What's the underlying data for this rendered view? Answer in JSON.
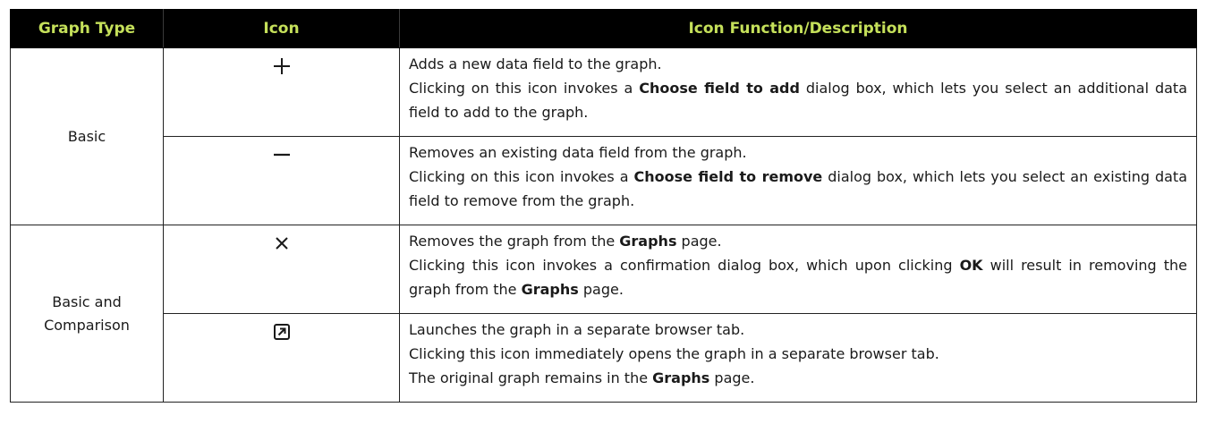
{
  "columns": {
    "graph_type": "Graph Type",
    "icon": "Icon",
    "description": "Icon Function/Description"
  },
  "groups": [
    {
      "graph_type": "Basic",
      "rows": [
        {
          "icon_name": "plus-icon",
          "summary": "Adds a new data field to the graph.",
          "detail": {
            "pre": "Clicking on this icon invokes a ",
            "bold": "Choose field to add",
            "post": " dialog box, which lets you select an additional data field to add to the graph."
          }
        },
        {
          "icon_name": "minus-icon",
          "summary": "Removes an existing data field from the graph.",
          "detail": {
            "pre": "Clicking on this icon invokes a ",
            "bold": "Choose field to remove",
            "post": " dialog box, which lets you select an existing data field to remove from the graph."
          }
        }
      ]
    },
    {
      "graph_type": "Basic and Comparison",
      "rows": [
        {
          "icon_name": "close-icon",
          "summary": {
            "pre": "Removes the graph from the ",
            "bold": "Graphs",
            "post": " page."
          },
          "detail": {
            "pre": "Clicking this icon invokes a confirmation dialog box, which upon clicking ",
            "bold": "OK",
            "mid": " will result in removing the graph from the ",
            "bold2": "Graphs",
            "post": " page."
          }
        },
        {
          "icon_name": "open-in-new-tab-icon",
          "summary": "Launches the graph in a separate browser tab.",
          "detail": "Clicking this icon immediately opens the graph in a separate browser tab.",
          "detail2": {
            "pre": "The original graph remains in the ",
            "bold": "Graphs",
            "post": " page."
          }
        }
      ]
    }
  ],
  "colors": {
    "header_bg": "#000000",
    "header_text": "#c5e05a",
    "border": "#222222"
  }
}
